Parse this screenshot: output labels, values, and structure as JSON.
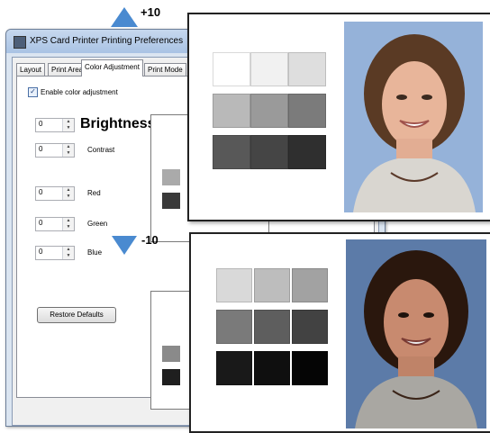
{
  "window": {
    "title": "XPS Card Printer Printing Preferences"
  },
  "tabs": [
    {
      "label": "Layout"
    },
    {
      "label": "Print Area"
    },
    {
      "label": "Color Adjustment"
    },
    {
      "label": "Print Mode"
    }
  ],
  "active_tab": "Color Adjustment",
  "color_adjustment": {
    "enable_label": "Enable color adjustment",
    "enabled": true,
    "brightness": {
      "label": "Brightness",
      "value": "0"
    },
    "contrast": {
      "label": "Contrast",
      "value": "0"
    },
    "red": {
      "label": "Red",
      "value": "0"
    },
    "green": {
      "label": "Green",
      "value": "0"
    },
    "blue": {
      "label": "Blue",
      "value": "0"
    },
    "restore_label": "Restore Defaults"
  },
  "annotations": {
    "increase": "+10",
    "decrease": "-10",
    "arrow_color": "#4a8ad0"
  },
  "samples": {
    "top_grays": [
      "#ffffff",
      "#f1f1f1",
      "#dedede",
      "#b9b9b9",
      "#9a9a9a",
      "#7b7b7b",
      "#585858",
      "#454545",
      "#2f2f2f"
    ],
    "bottom_grays": [
      "#d9d9d9",
      "#bdbdbd",
      "#a2a2a2",
      "#7a7a7a",
      "#5e5e5e",
      "#424242",
      "#191919",
      "#0f0f0f",
      "#050505"
    ],
    "top_photo_bg": "#95b2d9",
    "bottom_photo_bg": "#5c7ba8"
  }
}
